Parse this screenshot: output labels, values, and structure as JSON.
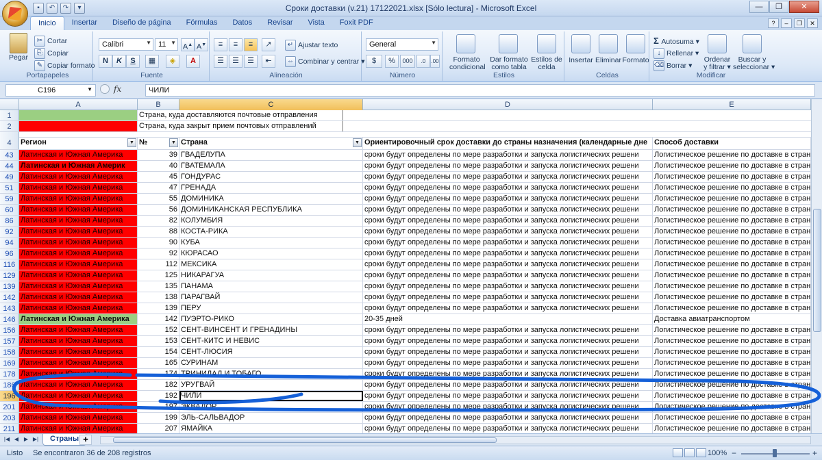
{
  "window": {
    "title": "Сроки доставки (v.21) 17122021.xlsx  [Sólo lectura] - Microsoft Excel"
  },
  "ribbon_tabs": [
    "Inicio",
    "Insertar",
    "Diseño de página",
    "Fórmulas",
    "Datos",
    "Revisar",
    "Vista",
    "Foxit PDF"
  ],
  "ribbon": {
    "portapapeles": {
      "label": "Portapapeles",
      "paste": "Pegar",
      "cut": "Cortar",
      "copy": "Copiar",
      "format_painter": "Copiar formato"
    },
    "fuente": {
      "label": "Fuente",
      "font": "Calibri",
      "size": "11",
      "bold": "N",
      "italic": "K",
      "underline": "S"
    },
    "alineacion": {
      "label": "Alineación",
      "wrap": "Ajustar texto",
      "merge": "Combinar y centrar"
    },
    "numero": {
      "label": "Número",
      "format": "General",
      "currency": "$",
      "percent": "%",
      "thousands": "000"
    },
    "estilos": {
      "label": "Estilos",
      "cond_1": "Formato",
      "cond_2": "condicional",
      "table_1": "Dar formato",
      "table_2": "como tabla",
      "cell_1": "Estilos de",
      "cell_2": "celda"
    },
    "celdas": {
      "label": "Celdas",
      "insert": "Insertar",
      "delete": "Eliminar",
      "format": "Formato"
    },
    "modificar": {
      "label": "Modificar",
      "autosum": "Autosuma",
      "fill": "Rellenar",
      "clear": "Borrar",
      "sort_1": "Ordenar",
      "sort_2": "y filtrar",
      "find_1": "Buscar y",
      "find_2": "seleccionar"
    }
  },
  "formula_bar": {
    "name_box": "C196",
    "fx": "fx",
    "value": "ЧИЛИ"
  },
  "columns": [
    "A",
    "B",
    "C",
    "D",
    "E"
  ],
  "legend_rows": [
    {
      "row": "1",
      "text": "Страна, куда доставляются почтовые отправления",
      "color": "#9bcf82"
    },
    {
      "row": "2",
      "text": "Страна, куда закрыт прием почтовых отправлений",
      "color": "#ff0000"
    }
  ],
  "header_row": {
    "row": "4",
    "a": "Регион",
    "b": "№",
    "c": "Страна",
    "d": "Ориентировочный срок доставки до страны назначения (календарные дне",
    "e": "Способ доставки"
  },
  "rows": [
    {
      "r": "43",
      "a": "Латинская и Южная Америка",
      "n": "39",
      "c": "ГВАДЕЛУПА",
      "d": "сроки будут определены по мере разработки и запуска логистических решени",
      "e": "Логистическое решение  по доставке в страну в",
      "s": "red"
    },
    {
      "r": "44",
      "a": "Латинская и Южная Америк",
      "n": "40",
      "c": "ГВАТЕМАЛА",
      "d": "сроки будут определены по мере разработки и запуска логистических решени",
      "e": "Логистическое решение  по доставке в страну в",
      "s": "redbold"
    },
    {
      "r": "49",
      "a": "Латинская и Южная Америка",
      "n": "45",
      "c": "ГОНДУРАС",
      "d": "сроки будут определены по мере разработки и запуска логистических решени",
      "e": "Логистическое решение  по доставке в страну в",
      "s": "red"
    },
    {
      "r": "51",
      "a": "Латинская и Южная Америка",
      "n": "47",
      "c": "ГРЕНАДА",
      "d": "сроки будут определены по мере разработки и запуска логистических решени",
      "e": "Логистическое решение  по доставке в страну в",
      "s": "red"
    },
    {
      "r": "59",
      "a": "Латинская и Южная Америка",
      "n": "55",
      "c": "ДОМИНИКА",
      "d": "сроки будут определены по мере разработки и запуска логистических решени",
      "e": "Логистическое решение  по доставке в страну в",
      "s": "red"
    },
    {
      "r": "60",
      "a": "Латинская и Южная Америка",
      "n": "56",
      "c": "ДОМИНИКАНСКАЯ РЕСПУБЛИКА",
      "d": "сроки будут определены по мере разработки и запуска логистических решени",
      "e": "Логистическое решение  по доставке в страну в",
      "s": "red"
    },
    {
      "r": "86",
      "a": "Латинская и Южная Америка",
      "n": "82",
      "c": "КОЛУМБИЯ",
      "d": "сроки будут определены по мере разработки и запуска логистических решени",
      "e": "Логистическое решение  по доставке в страну в",
      "s": "red"
    },
    {
      "r": "92",
      "a": "Латинская и Южная Америка",
      "n": "88",
      "c": "КОСТА-РИКА",
      "d": "сроки будут определены по мере разработки и запуска логистических решени",
      "e": "Логистическое решение  по доставке в страну в",
      "s": "red"
    },
    {
      "r": "94",
      "a": "Латинская и Южная Америка",
      "n": "90",
      "c": "КУБА",
      "d": "сроки будут определены по мере разработки и запуска логистических решени",
      "e": "Логистическое решение  по доставке в страну в",
      "s": "red"
    },
    {
      "r": "96",
      "a": "Латинская и Южная Америка",
      "n": "92",
      "c": "КЮРАСАО",
      "d": "сроки будут определены по мере разработки и запуска логистических решени",
      "e": "Логистическое решение  по доставке в страну в",
      "s": "red"
    },
    {
      "r": "116",
      "a": "Латинская и Южная Америка",
      "n": "112",
      "c": "МЕКСИКА",
      "d": "сроки будут определены по мере разработки и запуска логистических решени",
      "e": "Логистическое решение  по доставке в страну в",
      "s": "red"
    },
    {
      "r": "129",
      "a": "Латинская и Южная Америка",
      "n": "125",
      "c": "НИКАРАГУА",
      "d": "сроки будут определены по мере разработки и запуска логистических решени",
      "e": "Логистическое решение  по доставке в страну в",
      "s": "red"
    },
    {
      "r": "139",
      "a": "Латинская и Южная Америка",
      "n": "135",
      "c": "ПАНАМА",
      "d": "сроки будут определены по мере разработки и запуска логистических решени",
      "e": "Логистическое решение  по доставке в страну в",
      "s": "red"
    },
    {
      "r": "142",
      "a": "Латинская и Южная Америка",
      "n": "138",
      "c": "ПАРАГВАЙ",
      "d": "сроки будут определены по мере разработки и запуска логистических решени",
      "e": "Логистическое решение  по доставке в страну в",
      "s": "red"
    },
    {
      "r": "143",
      "a": "Латинская и Южная Америка",
      "n": "139",
      "c": "ПЕРУ",
      "d": "сроки будут определены по мере разработки и запуска логистических решени",
      "e": "Логистическое решение  по доставке в страну в",
      "s": "red"
    },
    {
      "r": "146",
      "a": "Латинская и Южная Америка",
      "n": "142",
      "c": "ПУЭРТО-РИКО",
      "d": "20-35 дней",
      "e": "Доставка авиатранспортом",
      "s": "green"
    },
    {
      "r": "156",
      "a": "Латинская и Южная Америка",
      "n": "152",
      "c": "СЕНТ-ВИНСЕНТ И ГРЕНАДИНЫ",
      "d": "сроки будут определены по мере разработки и запуска логистических решени",
      "e": "Логистическое решение  по доставке в страну в",
      "s": "red"
    },
    {
      "r": "157",
      "a": "Латинская и Южная Америка",
      "n": "153",
      "c": "СЕНТ-КИТС И НЕВИС",
      "d": "сроки будут определены по мере разработки и запуска логистических решени",
      "e": "Логистическое решение  по доставке в страну в",
      "s": "red"
    },
    {
      "r": "158",
      "a": "Латинская и Южная Америка",
      "n": "154",
      "c": "СЕНТ-ЛЮСИЯ",
      "d": "сроки будут определены по мере разработки и запуска логистических решени",
      "e": "Логистическое решение  по доставке в страну в",
      "s": "red"
    },
    {
      "r": "169",
      "a": "Латинская и Южная Америка",
      "n": "165",
      "c": "СУРИНАМ",
      "d": "сроки будут определены по мере разработки и запуска логистических решени",
      "e": "Логистическое решение  по доставке в страну в",
      "s": "red"
    },
    {
      "r": "178",
      "a": "Латинская и Южная Америка",
      "n": "174",
      "c": "ТРИНИДАД И ТОБАГО",
      "d": "сроки будут определены по мере разработки и запуска логистических решени",
      "e": "Логистическое решение  по доставке в страну в",
      "s": "red"
    },
    {
      "r": "186",
      "a": "Латинская и Южная Америка",
      "n": "182",
      "c": "УРУГВАЙ",
      "d": "сроки будут определены по мере разработки и запуска логистических решени",
      "e": "Логистическое решение  по доставке в страну в",
      "s": "red"
    },
    {
      "r": "196",
      "a": "Латинская и Южная Америка",
      "n": "192",
      "c": "ЧИЛИ",
      "d": "сроки будут определены по мере разработки и запуска логистических решени",
      "e": "Логистическое решение  по доставке в страну в",
      "s": "red",
      "active": true
    },
    {
      "r": "201",
      "a": "Латинская и Южная Америка",
      "n": "197",
      "c": "ЭКВАДОР",
      "d": "сроки будут определены по мере разработки и запуска логистических решени",
      "e": "Логистическое решение  по доставке в страну в",
      "s": "red"
    },
    {
      "r": "203",
      "a": "Латинская и Южная Америка",
      "n": "199",
      "c": "ЭЛЬ-САЛЬВАДОР",
      "d": "сроки будут определены по мере разработки и запуска логистических решени",
      "e": "Логистическое решение  по доставке в страну в",
      "s": "red"
    },
    {
      "r": "211",
      "a": "Латинская и Южная Америка",
      "n": "207",
      "c": "ЯМАЙКА",
      "d": "сроки будут определены по мере разработки и запуска логистических решени",
      "e": "Логистическое решение  по доставке в страну в",
      "s": "red"
    }
  ],
  "sheet_tab": "Страны",
  "status": {
    "ready": "Listo",
    "message": "Se encontraron 36 de 208 registros",
    "zoom": "100%",
    "zoom_minus": "−",
    "zoom_plus": "+"
  },
  "colors": {
    "closed": "#ff0000",
    "open": "#9bcf82",
    "annotation": "#1560d8"
  }
}
